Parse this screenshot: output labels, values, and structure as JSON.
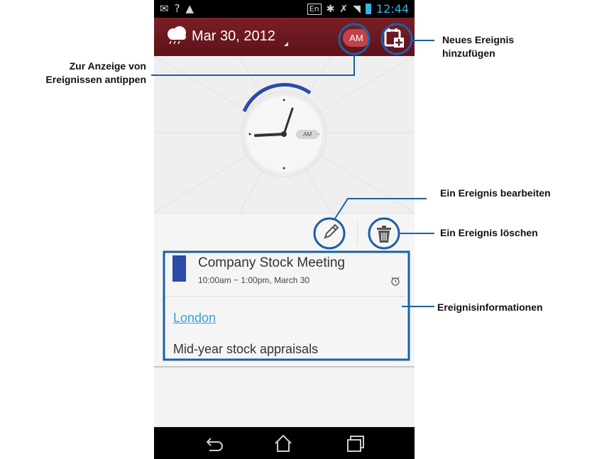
{
  "status_bar": {
    "lang": "En",
    "time": "12:44"
  },
  "header": {
    "date": "Mar 30, 2012",
    "am_pm": "AM"
  },
  "clock": {
    "am_label": "AM"
  },
  "event": {
    "title": "Company Stock Meeting",
    "time": "10:00am ~ 1:00pm, March 30",
    "location": "London",
    "description": "Mid-year stock appraisals",
    "color": "#2a4ba6"
  },
  "annotations": {
    "tap_events": "Zur Anzeige von Ereignissen antippen",
    "tap_events_line1": "Zur Anzeige von",
    "tap_events_line2": "Ereignissen antippen",
    "add_event_line1": "Neues Ereignis",
    "add_event_line2": "hinzufügen",
    "edit_event": "Ein Ereignis bearbeiten",
    "delete_event": "Ein Ereignis löschen",
    "event_info": "Ereignisinformationen"
  },
  "colors": {
    "header_bg": "#6a1820",
    "accent_blue": "#33b5e5",
    "callout": "#1c5fa8"
  },
  "icons": [
    "weather-icon",
    "add-event-icon",
    "edit-icon",
    "delete-icon",
    "alarm-icon",
    "back-icon",
    "home-icon",
    "recents-icon"
  ]
}
